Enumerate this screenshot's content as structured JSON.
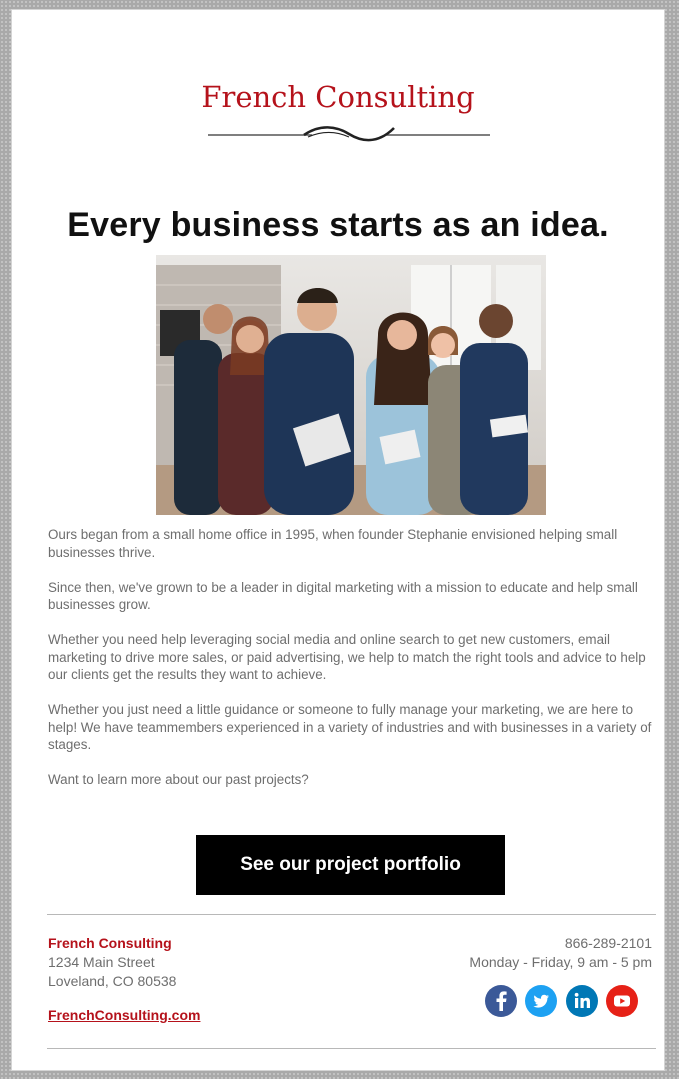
{
  "brand": {
    "name": "French Consulting",
    "color": "#b5121b"
  },
  "headline": "Every business starts as an idea.",
  "paragraphs": [
    "Ours began from a small home office in 1995, when founder Stephanie envisioned helping small businesses thrive.",
    "Since then, we've grown to be a leader in digital marketing with a mission to educate and help small businesses grow.",
    "Whether you need help leveraging social media and online search to get new customers, email marketing to drive more sales, or paid advertising, we help to match the right tools and advice to help our clients get the results they want to achieve.",
    "Whether you just need a little guidance or someone to fully manage your marketing, we are here to help! We have teammembers experienced in a variety of industries and with businesses in a variety of stages.",
    "Want to learn more about our past projects?"
  ],
  "cta_label": "See our project portfolio",
  "footer": {
    "company": "French Consulting",
    "street": "1234 Main Street",
    "city": "Loveland, CO 80538",
    "website": "FrenchConsulting.com",
    "phone": "866-289-2101",
    "hours": "Monday - Friday, 9 am - 5 pm"
  },
  "social": [
    {
      "name": "facebook-icon",
      "glyph": "f",
      "color": "#3b5998"
    },
    {
      "name": "twitter-icon",
      "glyph": "bird",
      "color": "#1da1f2"
    },
    {
      "name": "linkedin-icon",
      "glyph": "in",
      "color": "#0077b5"
    },
    {
      "name": "youtube-icon",
      "glyph": "play",
      "color": "#e62117"
    }
  ],
  "colors": {
    "page_background": "#a9a9a9",
    "card": "#ffffff",
    "text": "#6e6e6e",
    "button": "#000000"
  }
}
